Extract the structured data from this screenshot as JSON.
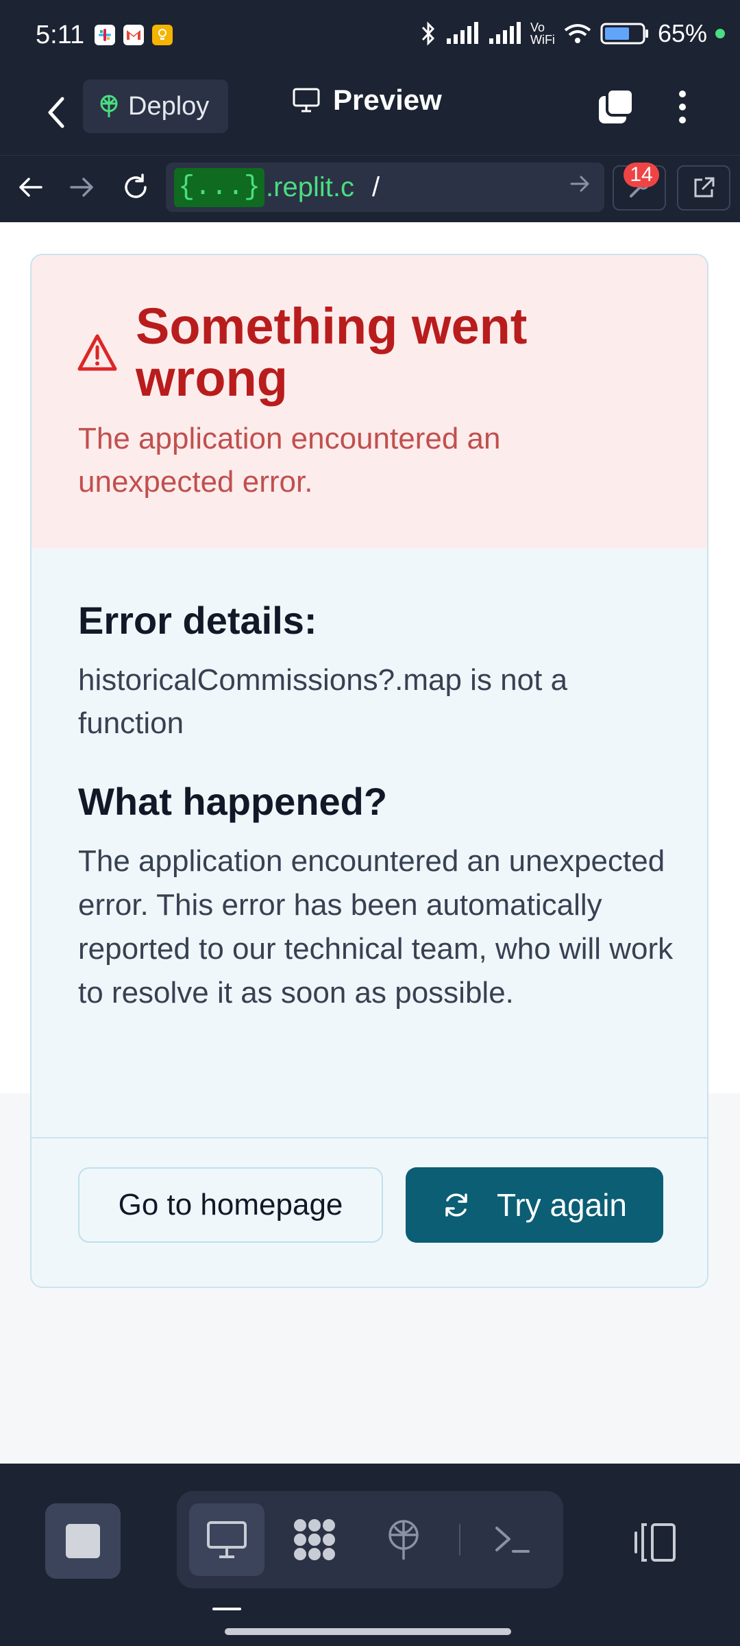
{
  "status_bar": {
    "time": "5:11",
    "battery": "65%",
    "vowifi_top": "Vo",
    "vowifi_bottom": "WiFi"
  },
  "toolbar": {
    "deploy_label": "Deploy",
    "preview_label": "Preview"
  },
  "url_bar": {
    "prefix": "{...}",
    "domain": ".replit.c",
    "path": "/",
    "badge_count": "14"
  },
  "error_card": {
    "title": "Something went wrong",
    "subtitle": "The application encountered an unexpected error.",
    "details_heading": "Error details:",
    "details_text": "historicalCommissions?.map is not a function",
    "happened_heading": "What happened?",
    "happened_text": "The application encountered an unexpected error. This error has been automatically reported to our technical team, who will work to resolve it as soon as possible.",
    "home_button": "Go to homepage",
    "retry_button": "Try again"
  },
  "colors": {
    "app_bg": "#1c2333",
    "error_red": "#b91c1c",
    "primary_button": "#0b5e74",
    "url_green": "#4ade80"
  }
}
